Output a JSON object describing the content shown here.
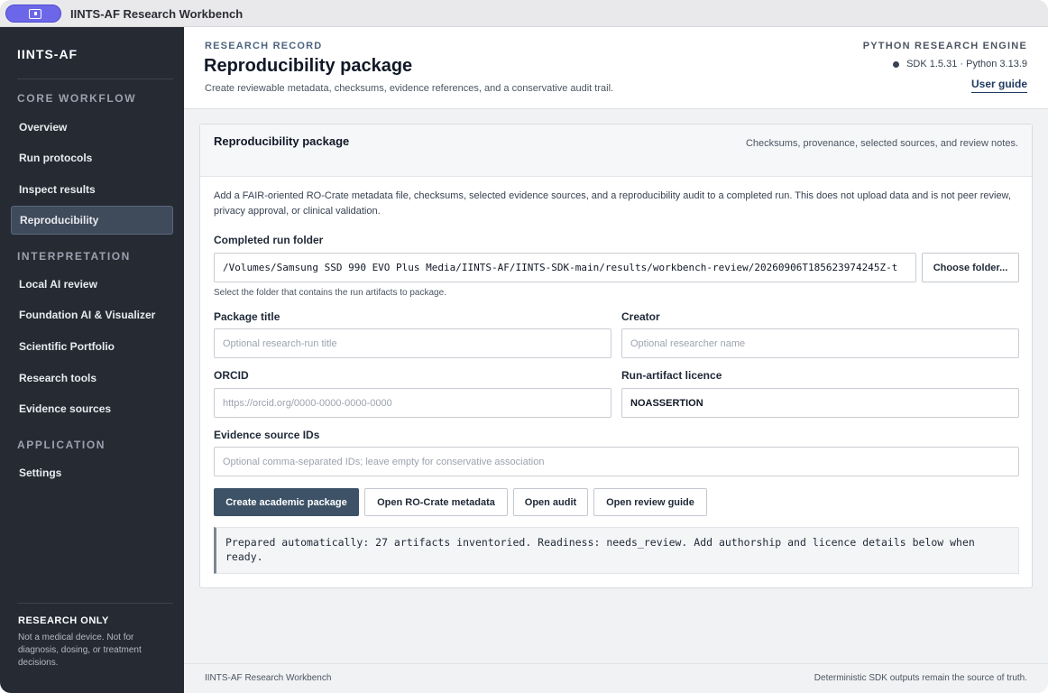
{
  "window": {
    "title": "IINTS-AF Research Workbench"
  },
  "sidebar": {
    "brand": "IINTS-AF",
    "sections": [
      {
        "label": "CORE WORKFLOW"
      },
      {
        "label": "INTERPRETATION"
      },
      {
        "label": "APPLICATION"
      }
    ],
    "items": [
      {
        "label": "Overview"
      },
      {
        "label": "Run protocols"
      },
      {
        "label": "Inspect results"
      },
      {
        "label": "Reproducibility",
        "active": true
      },
      {
        "label": "Local AI review"
      },
      {
        "label": "Foundation AI & Visualizer"
      },
      {
        "label": "Scientific Portfolio"
      },
      {
        "label": "Research tools"
      },
      {
        "label": "Evidence sources"
      },
      {
        "label": "Settings"
      }
    ],
    "research_only_title": "RESEARCH ONLY",
    "research_only_text": "Not a medical device. Not for diagnosis, dosing, or treatment decisions."
  },
  "header": {
    "eyebrow": "RESEARCH RECORD",
    "title": "Reproducibility package",
    "subtitle": "Create reviewable metadata, checksums, evidence references, and a conservative audit trail.",
    "engine": "PYTHON RESEARCH ENGINE",
    "sdk": "SDK 1.5.31 · Python 3.13.9",
    "guide": "User guide"
  },
  "card": {
    "title": "Reproducibility package",
    "note": "Checksums, provenance, selected sources, and review notes.",
    "intro": "Add a FAIR-oriented RO-Crate metadata file, checksums, selected evidence sources, and a reproducibility audit to a completed run. This does not upload data and is not peer review, privacy approval, or clinical validation.",
    "run_folder_label": "Completed run folder",
    "run_folder_value": "/Volumes/Samsung SSD 990 EVO Plus Media/IINTS-AF/IINTS-SDK-main/results/workbench-review/20260906T185623974245Z-t",
    "choose_folder": "Choose folder...",
    "run_folder_hint": "Select the folder that contains the run artifacts to package.",
    "package_title_label": "Package title",
    "package_title_placeholder": "Optional research-run title",
    "creator_label": "Creator",
    "creator_placeholder": "Optional researcher name",
    "orcid_label": "ORCID",
    "orcid_placeholder": "https://orcid.org/0000-0000-0000-0000",
    "licence_label": "Run-artifact licence",
    "licence_value": "NOASSERTION",
    "evidence_label": "Evidence source IDs",
    "evidence_placeholder": "Optional comma-separated IDs; leave empty for conservative association",
    "buttons": {
      "create": "Create academic package",
      "open_metadata": "Open RO-Crate metadata",
      "open_audit": "Open audit",
      "open_guide": "Open review guide"
    },
    "log": "Prepared automatically: 27 artifacts inventoried. Readiness: needs_review. Add authorship and licence details below when ready."
  },
  "footer": {
    "left": "IINTS-AF Research Workbench",
    "right": "Deterministic SDK outputs remain the source of truth."
  },
  "colors": {
    "sidebar": "#252a33",
    "accent_button": "#3d5267",
    "titlebar_pill": "#6b67e8"
  }
}
